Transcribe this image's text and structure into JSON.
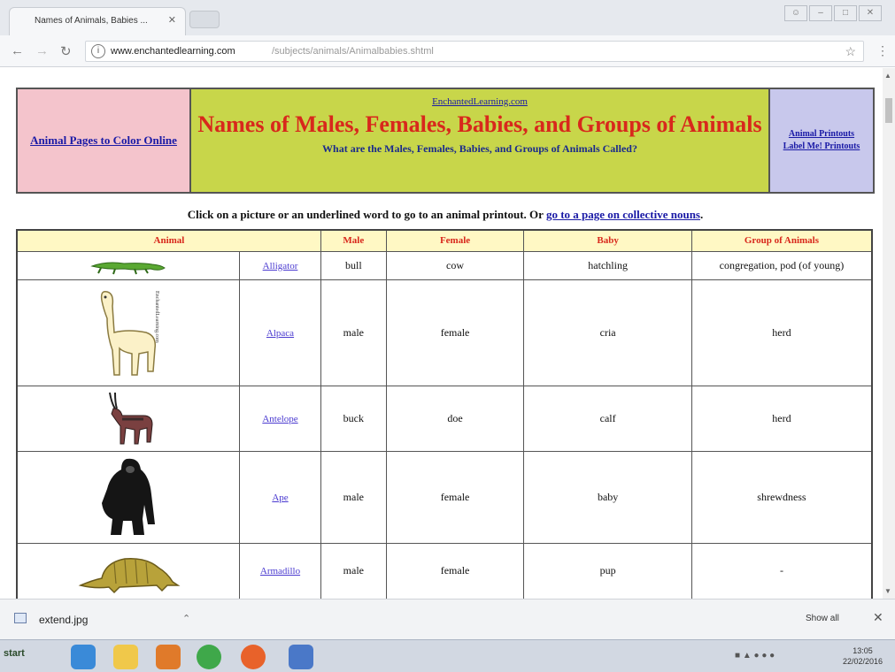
{
  "browser": {
    "tab_title": "Names of Animals, Babies ...",
    "url_host": "www.enchantedlearning.com",
    "url_path": "/subjects/animals/Animalbabies.shtml"
  },
  "banner": {
    "left_link": "Animal Pages to Color Online",
    "site_link": "EnchantedLearning.com",
    "title": "Names of Males, Females, Babies, and Groups of Animals",
    "subtitle": "What are the Males, Females, Babies, and Groups of Animals Called?",
    "right_link_1": "Animal Printouts",
    "right_link_2": "Label Me! Printouts"
  },
  "instruction": {
    "text": "Click on a picture or an underlined word to go to an animal printout. Or",
    "link": "go to a page on collective nouns",
    "end": "."
  },
  "table": {
    "headers": [
      "Animal",
      "Male",
      "Female",
      "Baby",
      "Group of Animals"
    ],
    "rows": [
      {
        "name": "Alligator",
        "male": "bull",
        "female": "cow",
        "baby": "hatchling",
        "group": "congregation, pod (of young)"
      },
      {
        "name": "Alpaca",
        "male": "male",
        "female": "female",
        "baby": "cria",
        "group": "herd"
      },
      {
        "name": "Antelope",
        "male": "buck",
        "female": "doe",
        "baby": "calf",
        "group": "herd"
      },
      {
        "name": "Ape",
        "male": "male",
        "female": "female",
        "baby": "baby",
        "group": "shrewdness"
      },
      {
        "name": "Armadillo",
        "male": "male",
        "female": "female",
        "baby": "pup",
        "group": "-"
      }
    ],
    "image_credit": "EnchantedLearning.com"
  },
  "download": {
    "file": "extend.jpg",
    "show_all": "Show all"
  },
  "taskbar": {
    "start": "start",
    "time": "13:05",
    "date": "22/02/2016"
  },
  "colors": {
    "banner_left": "#f4c4cc",
    "banner_mid": "#c8d64a",
    "banner_right": "#c8c8ec",
    "title_red": "#d8281c",
    "header_bg": "#fff8c4"
  }
}
